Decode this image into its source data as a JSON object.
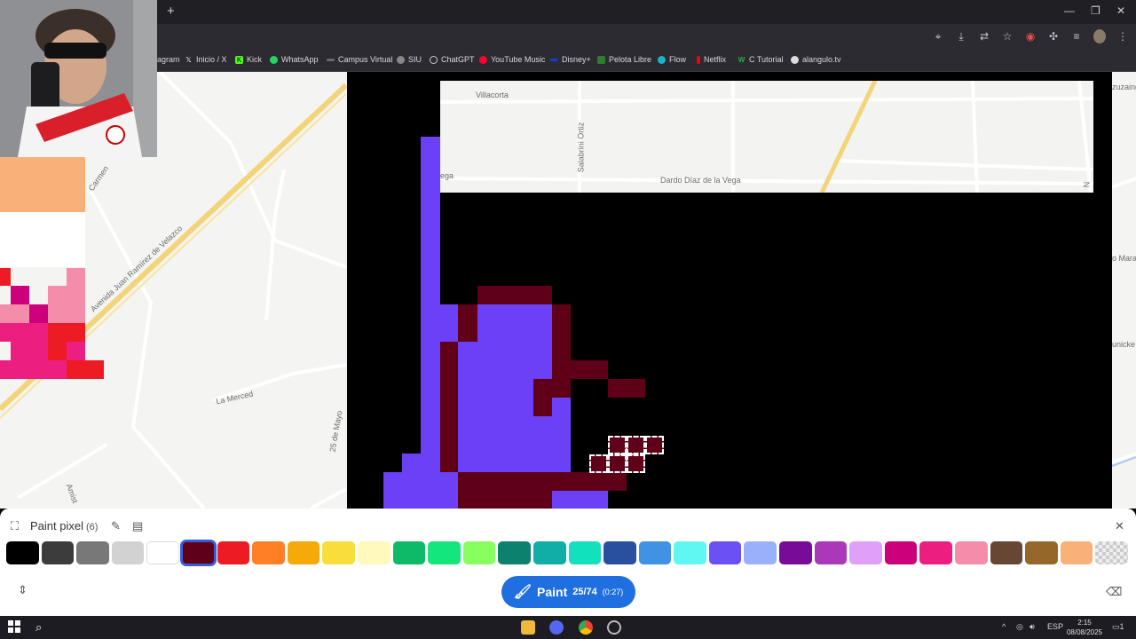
{
  "browser": {
    "new_tab_label": "+",
    "window_controls": {
      "minimize": "—",
      "restore": "❐",
      "close": "✕"
    },
    "bookmarks": [
      {
        "label": "agram",
        "icon": "instagram-icon",
        "color": "#c13584"
      },
      {
        "label": "Inicio / X",
        "icon": "x-icon",
        "color": "#000000"
      },
      {
        "label": "Kick",
        "icon": "kick-icon",
        "color": "#53fc18"
      },
      {
        "label": "WhatsApp",
        "icon": "whatsapp-icon",
        "color": "#25d366"
      },
      {
        "label": "Campus Virtual",
        "icon": "campus-icon",
        "color": "#6a6a6a"
      },
      {
        "label": "SIU",
        "icon": "siu-icon",
        "color": "#888888"
      },
      {
        "label": "ChatGPT",
        "icon": "chatgpt-icon",
        "color": "#555555"
      },
      {
        "label": "YouTube Music",
        "icon": "youtube-music-icon",
        "color": "#ff0033"
      },
      {
        "label": "Disney+",
        "icon": "disney-icon",
        "color": "#113ccf"
      },
      {
        "label": "Pelota Libre",
        "icon": "pelota-libre-icon",
        "color": "#2e7d32"
      },
      {
        "label": "Flow",
        "icon": "flow-icon",
        "color": "#1ab2c9"
      },
      {
        "label": "Netflix",
        "icon": "netflix-icon",
        "color": "#e50914"
      },
      {
        "label": "C Tutorial",
        "icon": "c-tutorial-icon",
        "color": "#2aa845"
      },
      {
        "label": "alangulo.tv",
        "icon": "alangulo-icon",
        "color": "#444444"
      }
    ]
  },
  "map": {
    "streets": [
      "Villacorta",
      "Salabrini Ortiz",
      "Dardo Díaz de la Vega",
      "ega",
      "Avenida Juan Ramírez de Velazco",
      "La Merced",
      "25 de Mayo",
      "Amist",
      "Carmen",
      "zuzaing",
      "o Mara",
      "unicke",
      "N"
    ]
  },
  "panel": {
    "title": "Paint pixel",
    "count": "(6)",
    "paint_label": "Paint",
    "progress": "25/74",
    "timer": "(0:27)",
    "selected_color": "#600018",
    "palette": [
      "#000000",
      "#3c3c3c",
      "#787878",
      "#d2d2d2",
      "#ffffff",
      "#600018",
      "#ed1c24",
      "#ff7f27",
      "#f6aa09",
      "#f9dd3b",
      "#fffabc",
      "#0eb968",
      "#13e67b",
      "#87ff5e",
      "#0c816e",
      "#10aea6",
      "#13e1be",
      "#28509e",
      "#4093e4",
      "#60f7f2",
      "#6b50f6",
      "#99b1fb",
      "#780c99",
      "#aa38b9",
      "#e09ff9",
      "#cb007a",
      "#ec1f80",
      "#f38da9",
      "#684634",
      "#95682a",
      "#f8b277",
      "transparent"
    ]
  },
  "taskbar": {
    "tray_lang": "ESP",
    "time": "2:15",
    "date": "08/08/2025",
    "notifications": "1"
  }
}
